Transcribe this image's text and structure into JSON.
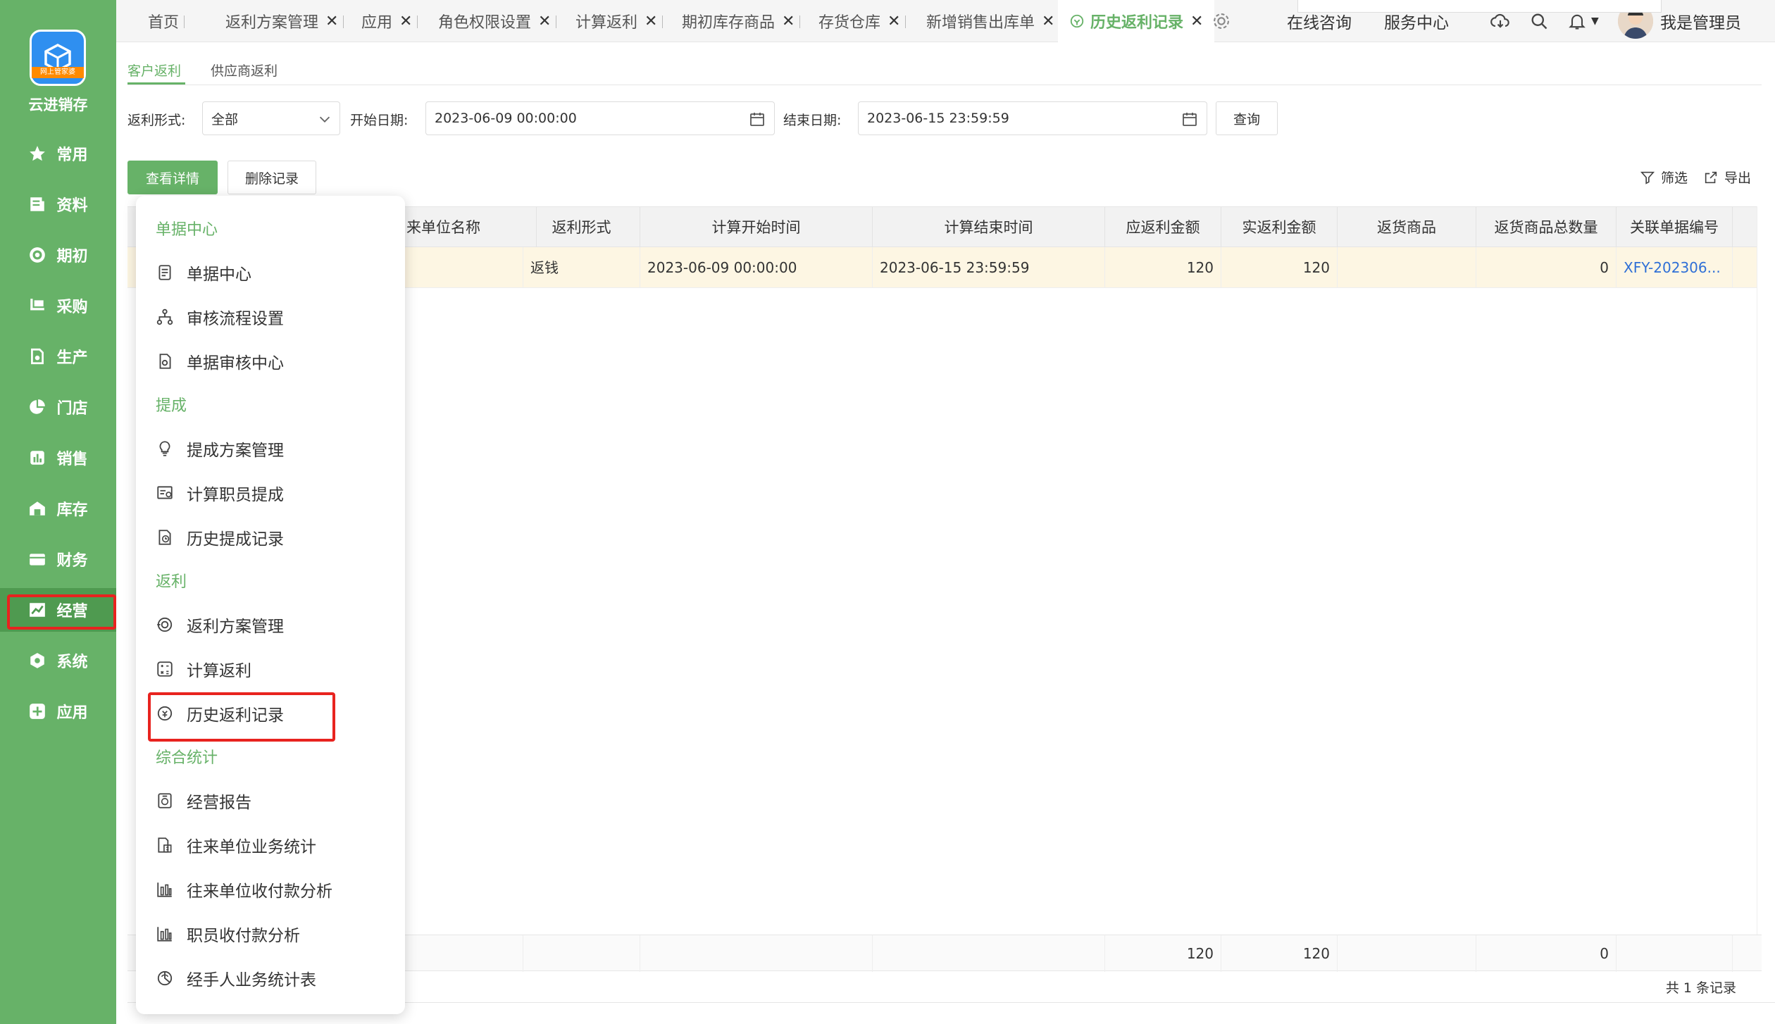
{
  "app": {
    "name": "云进销存",
    "logo_text": "网上管家婆"
  },
  "sidebar": {
    "items": [
      {
        "label": "常用",
        "icon": "star-icon"
      },
      {
        "label": "资料",
        "icon": "document-icon"
      },
      {
        "label": "期初",
        "icon": "target-icon"
      },
      {
        "label": "采购",
        "icon": "cart-icon"
      },
      {
        "label": "生产",
        "icon": "factory-icon"
      },
      {
        "label": "门店",
        "icon": "pie-icon"
      },
      {
        "label": "销售",
        "icon": "bar-chart-icon"
      },
      {
        "label": "库存",
        "icon": "warehouse-icon"
      },
      {
        "label": "财务",
        "icon": "wallet-icon"
      },
      {
        "label": "经营",
        "icon": "trend-icon"
      },
      {
        "label": "系统",
        "icon": "hexagon-icon"
      },
      {
        "label": "应用",
        "icon": "plus-square-icon"
      }
    ],
    "active": "经营"
  },
  "tabs": [
    {
      "label": "首页",
      "closable": false
    },
    {
      "label": "返利方案管理",
      "closable": true
    },
    {
      "label": "应用",
      "closable": true
    },
    {
      "label": "角色权限设置",
      "closable": true
    },
    {
      "label": "计算返利",
      "closable": true
    },
    {
      "label": "期初库存商品",
      "closable": true
    },
    {
      "label": "存货仓库",
      "closable": true
    },
    {
      "label": "新增销售出库单",
      "closable": true
    },
    {
      "label": "历史返利记录",
      "closable": true,
      "active": true
    }
  ],
  "topbar_right": {
    "consult": "在线咨询",
    "service": "服务中心",
    "user": "我是管理员"
  },
  "subtabs": [
    "客户返利",
    "供应商返利"
  ],
  "filters": {
    "type_label": "返利形式:",
    "type_value": "全部",
    "start_label": "开始日期:",
    "start_value": "2023-06-09 00:00:00",
    "end_label": "结束日期:",
    "end_value": "2023-06-15 23:59:59",
    "query_button": "查询"
  },
  "actions": {
    "view_detail": "查看详情",
    "delete_record": "删除记录",
    "filter": "筛选",
    "export": "导出"
  },
  "table": {
    "columns": [
      "来单位名称",
      "返利形式",
      "计算开始时间",
      "计算结束时间",
      "应返利金额",
      "实返利金额",
      "返货商品",
      "返货商品总数量",
      "关联单据编号"
    ],
    "rows": [
      {
        "unit": "",
        "type": "返钱",
        "start": "2023-06-09 00:00:00",
        "end": "2023-06-15 23:59:59",
        "due": "120",
        "actual": "120",
        "goods": "",
        "goods_qty": "0",
        "ref": "XFY-202306..."
      }
    ],
    "summary": {
      "due": "120",
      "actual": "120",
      "goods_qty": "0"
    },
    "total_text": "共 1 条记录"
  },
  "menu": {
    "groups": [
      {
        "title": "单据中心",
        "items": [
          {
            "label": "单据中心",
            "icon": "doc-list-icon"
          },
          {
            "label": "审核流程设置",
            "icon": "flow-icon"
          },
          {
            "label": "单据审核中心",
            "icon": "doc-check-icon"
          }
        ]
      },
      {
        "title": "提成",
        "items": [
          {
            "label": "提成方案管理",
            "icon": "bulb-icon"
          },
          {
            "label": "计算职员提成",
            "icon": "calc-staff-icon"
          },
          {
            "label": "历史提成记录",
            "icon": "history-money-icon"
          }
        ]
      },
      {
        "title": "返利",
        "items": [
          {
            "label": "返利方案管理",
            "icon": "rebate-plan-icon"
          },
          {
            "label": "计算返利",
            "icon": "calculator-icon"
          },
          {
            "label": "历史返利记录",
            "icon": "rebate-history-icon"
          }
        ]
      },
      {
        "title": "综合统计",
        "items": [
          {
            "label": "经营报告",
            "icon": "report-icon"
          },
          {
            "label": "往来单位业务统计",
            "icon": "unit-stat-icon"
          },
          {
            "label": "往来单位收付款分析",
            "icon": "bar-analysis-icon"
          },
          {
            "label": "职员收付款分析",
            "icon": "staff-analysis-icon"
          },
          {
            "label": "经手人业务统计表",
            "icon": "handler-stat-icon"
          }
        ]
      }
    ]
  },
  "colors": {
    "brand_green": "#67b268",
    "highlight_red": "#e8231f",
    "link_blue": "#2f6fd6"
  }
}
